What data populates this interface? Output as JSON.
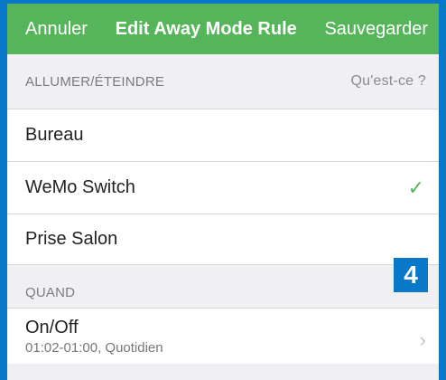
{
  "nav": {
    "cancel": "Annuler",
    "title": "Edit Away Mode Rule",
    "save": "Sauvegarder"
  },
  "section_onoff": {
    "label": "ALLUMER/ÉTEINDRE",
    "help": "Qu'est-ce ?"
  },
  "devices": [
    {
      "name": "Bureau",
      "checked": false
    },
    {
      "name": "WeMo Switch",
      "checked": true
    },
    {
      "name": "Prise Salon",
      "checked": false
    }
  ],
  "check_glyph": "✓",
  "section_when": {
    "label": "QUAND"
  },
  "schedule": {
    "title": "On/Off",
    "detail": "01:02-01:00, Quotidien"
  },
  "chevron_glyph": "›",
  "badge_number": "4",
  "colors": {
    "accent_green": "#56b55b",
    "frame_blue": "#0a78c8"
  }
}
